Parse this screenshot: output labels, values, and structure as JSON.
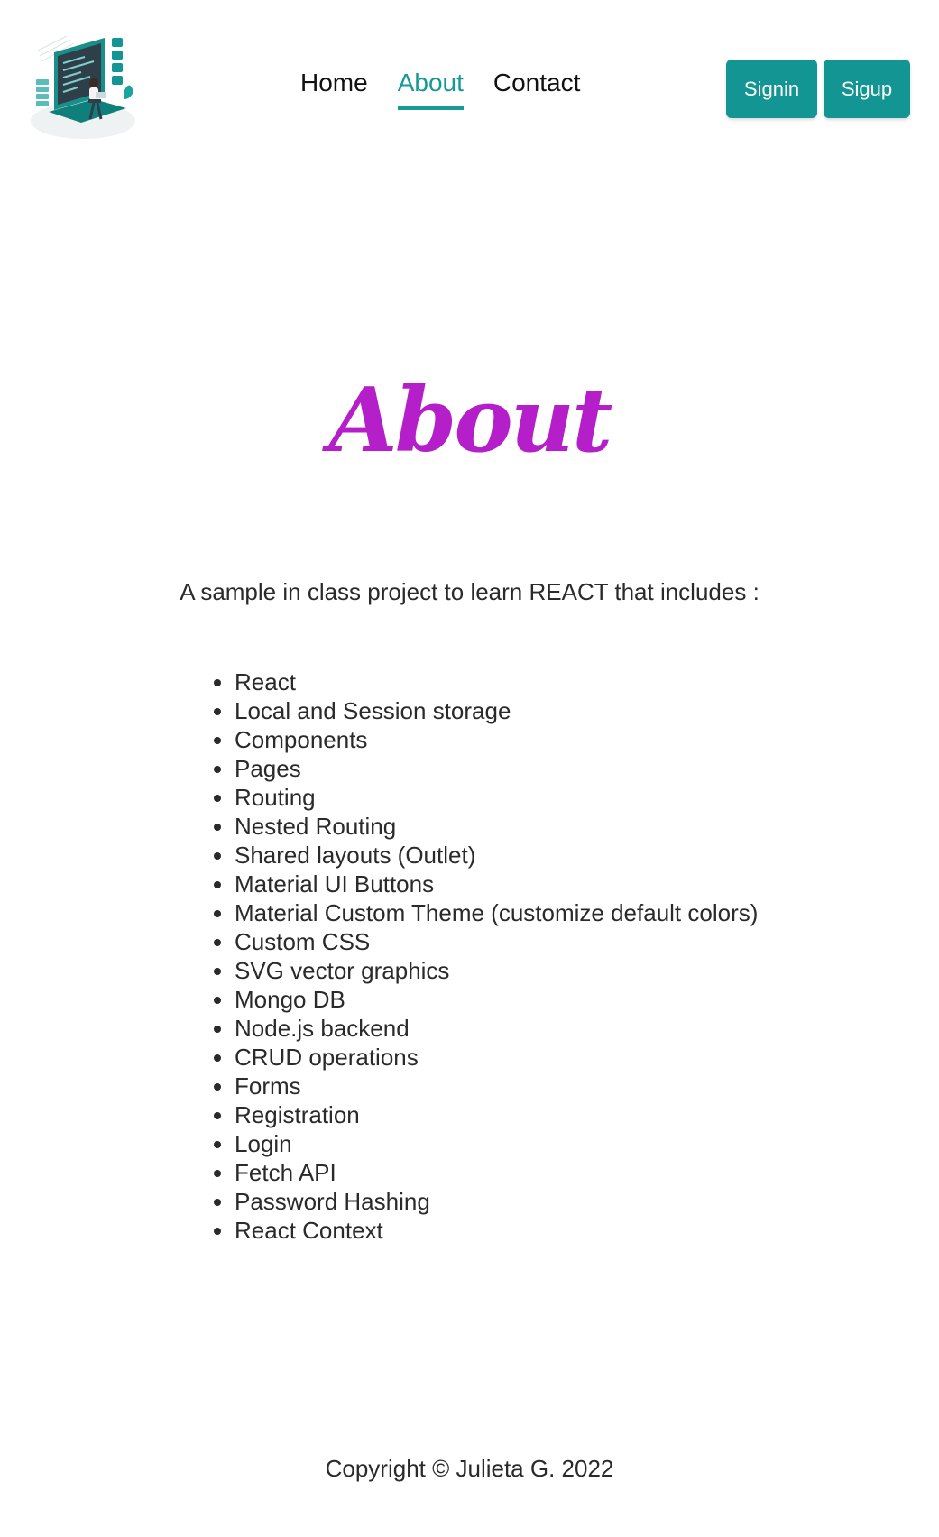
{
  "header": {
    "logo_alt": "developer illustration logo",
    "nav": [
      {
        "label": "Home",
        "active": false
      },
      {
        "label": "About",
        "active": true
      },
      {
        "label": "Contact",
        "active": false
      }
    ],
    "signin_label": "Signin",
    "signup_label": "Sigup"
  },
  "main": {
    "title": "About",
    "intro": "A sample in class project to learn REACT that includes :",
    "features": [
      "React",
      "Local and Session storage",
      "Components",
      "Pages",
      "Routing",
      "Nested Routing",
      "Shared layouts (Outlet)",
      "Material UI Buttons",
      "Material Custom Theme (customize default colors)",
      "Custom CSS",
      "SVG vector graphics",
      "Mongo DB",
      "Node.js backend",
      "CRUD operations",
      "Forms",
      "Registration",
      "Login",
      "Fetch API",
      "Password Hashing",
      "React Context"
    ]
  },
  "footer": {
    "copyright": "Copyright © Julieta G. 2022"
  },
  "colors": {
    "accent": "#129593",
    "title": "#b41fc9",
    "text": "#2a2a2a"
  }
}
